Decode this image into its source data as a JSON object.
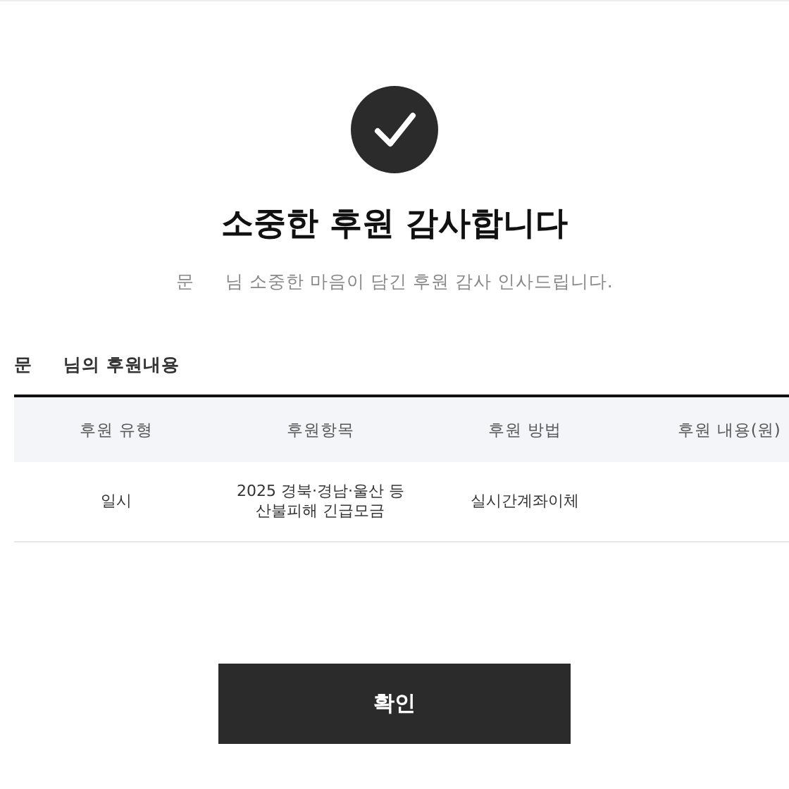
{
  "header": {
    "title": "소중한 후원 감사합니다",
    "donor_name": "문",
    "message": "님 소중한 마음이 담긴 후원 감사 인사드립니다."
  },
  "details": {
    "donor_name": "문",
    "heading": "님의 후원내용",
    "columns": [
      "후원 유형",
      "후원항목",
      "후원 방법",
      "후원 내용(원)"
    ],
    "rows": [
      [
        "일시",
        "2025 경북·경남·울산 등\n산불피해 긴급모금",
        "실시간계좌이체"
      ]
    ]
  },
  "confirm_button": "확인"
}
